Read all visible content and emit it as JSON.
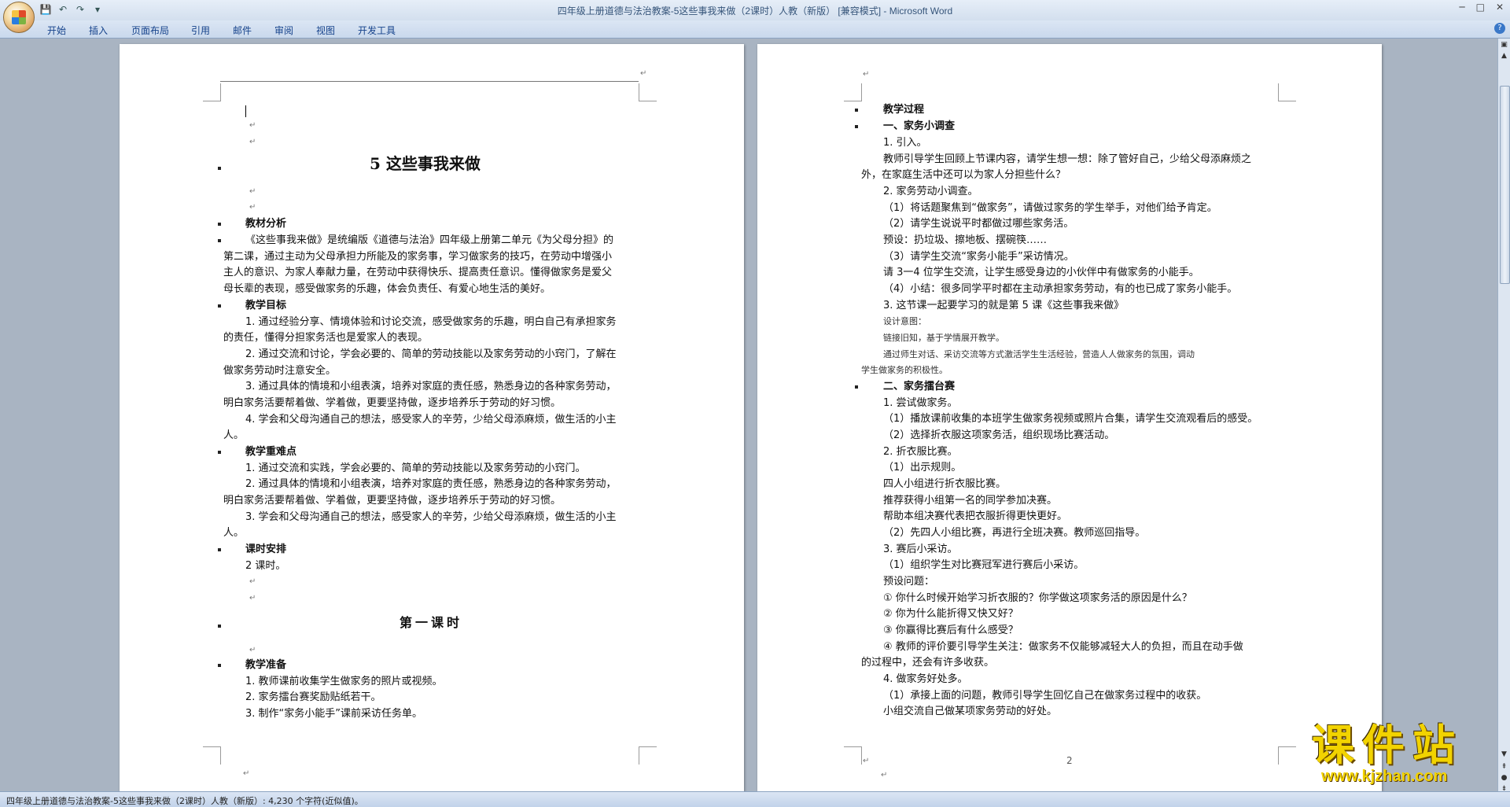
{
  "window": {
    "title": "四年级上册道德与法治教案-5这些事我来做（2课时）人教（新版） [兼容模式] - Microsoft Word",
    "controls": [
      "─",
      "□",
      "✕"
    ]
  },
  "quick_access": [
    "save-icon",
    "undo-icon",
    "redo-icon",
    "customize-icon"
  ],
  "ribbon": {
    "tabs": [
      "开始",
      "插入",
      "页面布局",
      "引用",
      "邮件",
      "审阅",
      "视图",
      "开发工具"
    ],
    "help": "?"
  },
  "page1": {
    "lines": [
      "5 这些事我来做",
      "教材分析",
      "《这些事我来做》是统编版《道德与法治》四年级上册第二单元《为父母分担》的",
      "第二课，通过主动为父母承担力所能及的家务事，学习做家务的技巧，在劳动中增强小",
      "主人的意识、为家人奉献力量，在劳动中获得快乐、提高责任意识。懂得做家务是爱父",
      "母长辈的表现，感受做家务的乐趣，体会负责任、有爱心地生活的美好。",
      "教学目标",
      "1. 通过经验分享、情境体验和讨论交流，感受做家务的乐趣，明白自己有承担家务",
      "的责任，懂得分担家务活也是爱家人的表现。",
      "2. 通过交流和讨论，学会必要的、简单的劳动技能以及家务劳动的小窍门，了解在",
      "做家务劳动时注意安全。",
      "3. 通过具体的情境和小组表演，培养对家庭的责任感，熟悉身边的各种家务劳动，",
      "明白家务活要帮着做、学着做，更要坚持做，逐步培养乐于劳动的好习惯。",
      "4. 学会和父母沟通自己的想法，感受家人的辛劳，少给父母添麻烦，做生活的小主",
      "人。",
      "教学重难点",
      "1. 通过交流和实践，学会必要的、简单的劳动技能以及家务劳动的小窍门。",
      "2. 通过具体的情境和小组表演，培养对家庭的责任感，熟悉身边的各种家务劳动，",
      "明白家务活要帮着做、学着做，更要坚持做，逐步培养乐于劳动的好习惯。",
      "3. 学会和父母沟通自己的想法，感受家人的辛劳，少给父母添麻烦，做生活的小主",
      "人。",
      "课时安排",
      "2 课时。",
      "第一课时",
      "教学准备",
      "1. 教师课前收集学生做家务的照片或视频。",
      "2. 家务擂台赛奖励贴纸若干。",
      "3. 制作“家务小能手”课前采访任务单。"
    ]
  },
  "page2": {
    "lines": [
      "教学过程",
      "一、家务小调查",
      "1. 引入。",
      "教师引导学生回顾上节课内容，请学生想一想：除了管好自己，少给父母添麻烦之",
      "外，在家庭生活中还可以为家人分担些什么？",
      "2. 家务劳动小调查。",
      "（1）将话题聚焦到“做家务”，请做过家务的学生举手，对他们给予肯定。",
      "（2）请学生说说平时都做过哪些家务活。",
      "预设：扔垃圾、擦地板、摆碗筷……",
      "（3）请学生交流“家务小能手”采访情况。",
      "请 3一4 位学生交流，让学生感受身边的小伙伴中有做家务的小能手。",
      "（4）小结：很多同学平时都在主动承担家务劳动，有的也已成了家务小能手。",
      "3. 这节课一起要学习的就是第 5 课《这些事我来做》",
      "设计意图：",
      "链接旧知，基于学情展开教学。",
      "通过师生对话、采访交流等方式激活学生生活经验，营造人人做家务的氛围，调动",
      "学生做家务的积极性。",
      "二、家务擂台赛",
      "1. 尝试做家务。",
      "（1）播放课前收集的本班学生做家务视频或照片合集，请学生交流观看后的感受。",
      "（2）选择折衣服这项家务活，组织现场比赛活动。",
      "2. 折衣服比赛。",
      "（1）出示规则。",
      "四人小组进行折衣服比赛。",
      "推荐获得小组第一名的同学参加决赛。",
      "帮助本组决赛代表把衣服折得更快更好。",
      "（2）先四人小组比赛，再进行全班决赛。教师巡回指导。",
      "3. 赛后小采访。",
      "（1）组织学生对比赛冠军进行赛后小采访。",
      "预设问题：",
      "① 你什么时候开始学习折衣服的？你学做这项家务活的原因是什么？",
      "② 你为什么能折得又快又好？",
      "③ 你赢得比赛后有什么感受？",
      "④ 教师的评价要引导学生关注：做家务不仅能够减轻大人的负担，而且在动手做",
      "的过程中，还会有许多收获。",
      "4. 做家务好处多。",
      "（1）承接上面的问题，教师引导学生回忆自己在做家务过程中的收获。",
      "小组交流自己做某项家务劳动的好处。"
    ],
    "page_number": "2"
  },
  "status": {
    "text": "四年级上册道德与法治教案-5这些事我来做（2课时）人教（新版）: 4,230 个字符(近似值)。"
  },
  "watermark": {
    "cn": "课件站",
    "url": "www.kjzhan.com"
  }
}
